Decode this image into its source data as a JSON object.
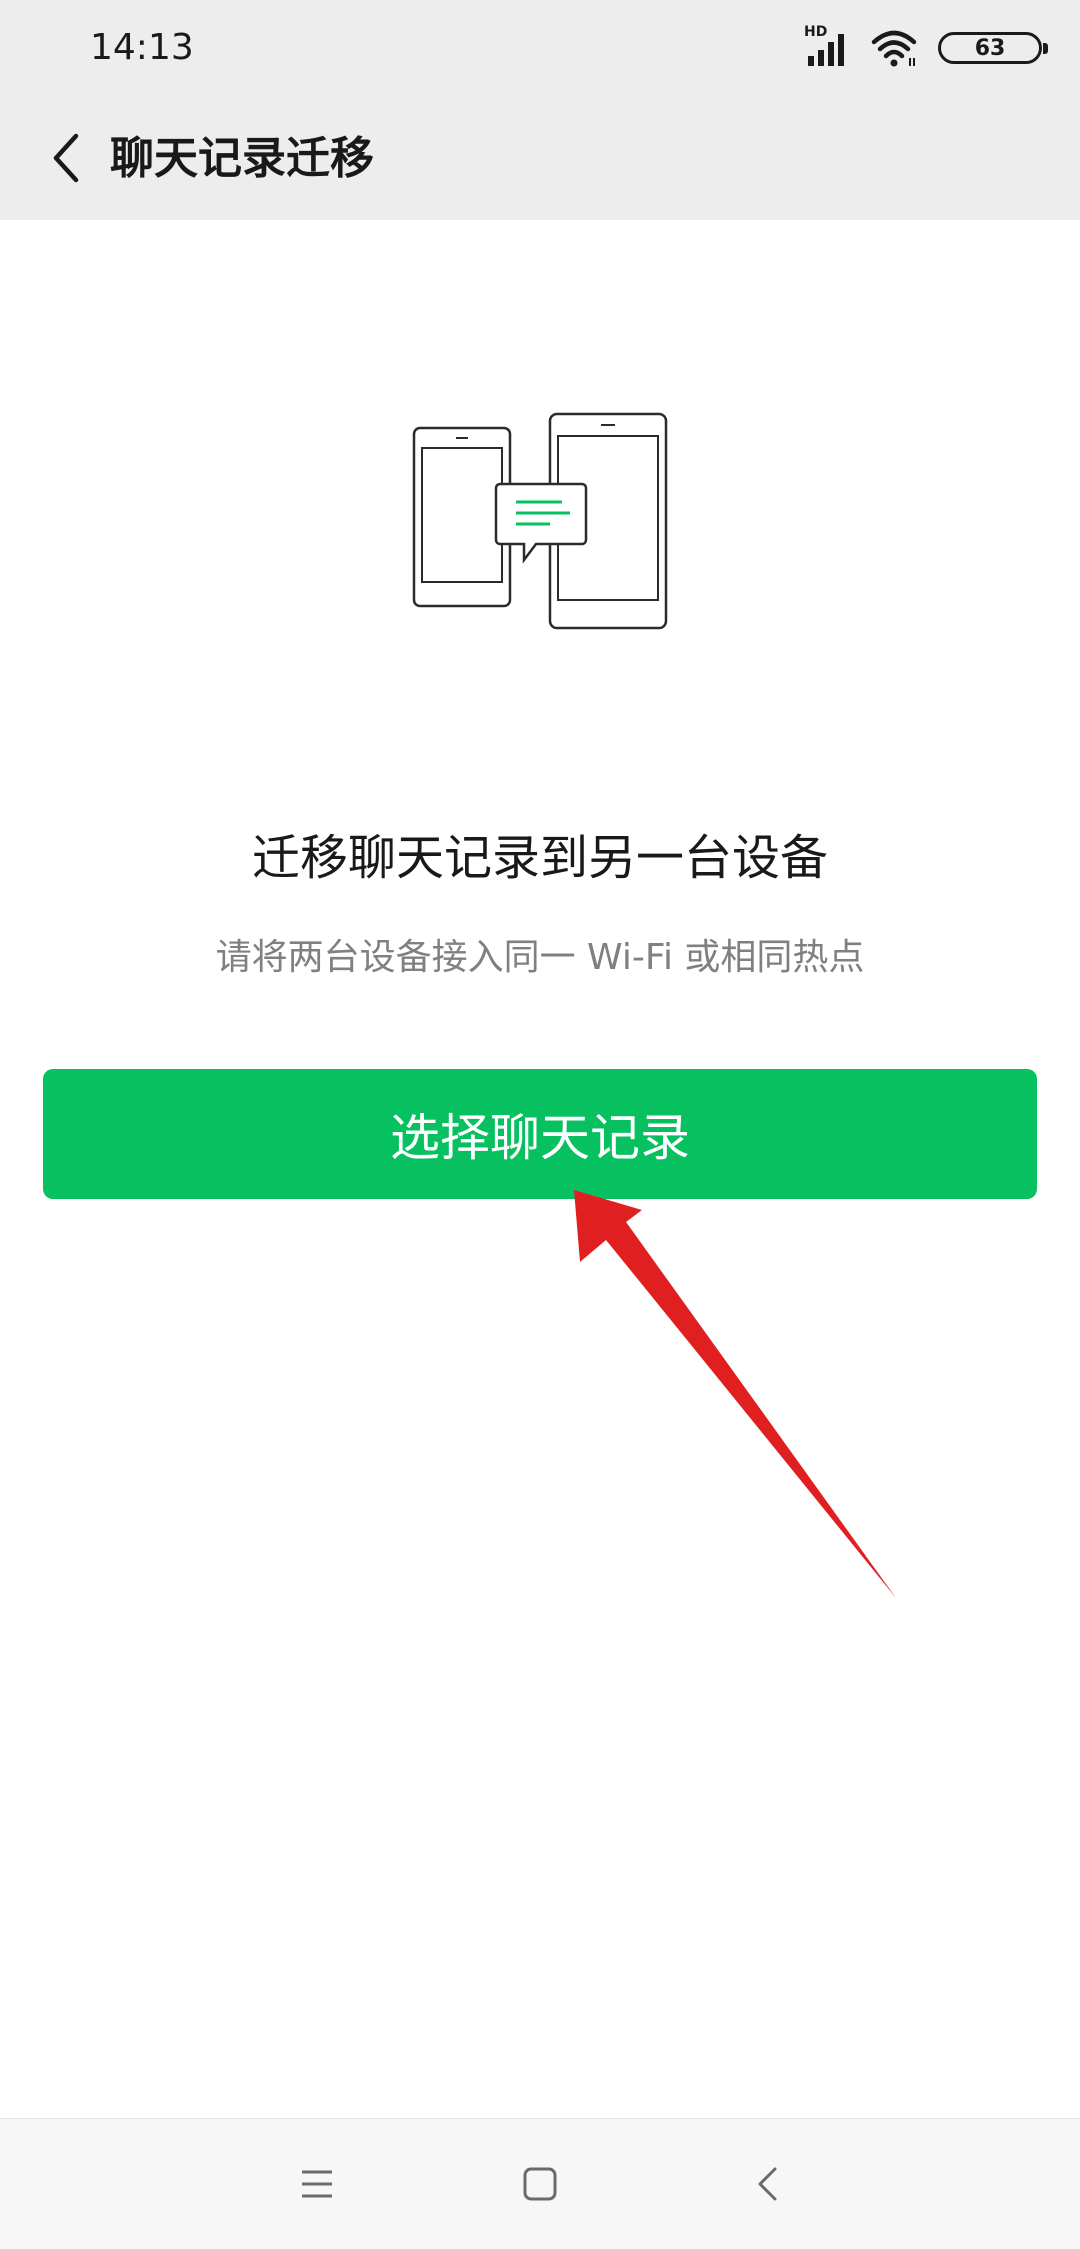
{
  "status_bar": {
    "time": "14:13",
    "network_label": "HD",
    "battery_level": "63"
  },
  "app_bar": {
    "title": "聊天记录迁移"
  },
  "main": {
    "headline": "迁移聊天记录到另一台设备",
    "subtext": "请将两台设备接入同一 Wi-Fi 或相同热点",
    "primary_button_label": "选择聊天记录"
  },
  "colors": {
    "accent_green": "#07c160",
    "annotation_red": "#e02020"
  },
  "icons": {
    "back": "chevron-left-icon",
    "illustration": "phone-transfer-icon",
    "nav_menu": "menu-icon",
    "nav_home": "home-icon",
    "nav_back": "back-icon"
  }
}
